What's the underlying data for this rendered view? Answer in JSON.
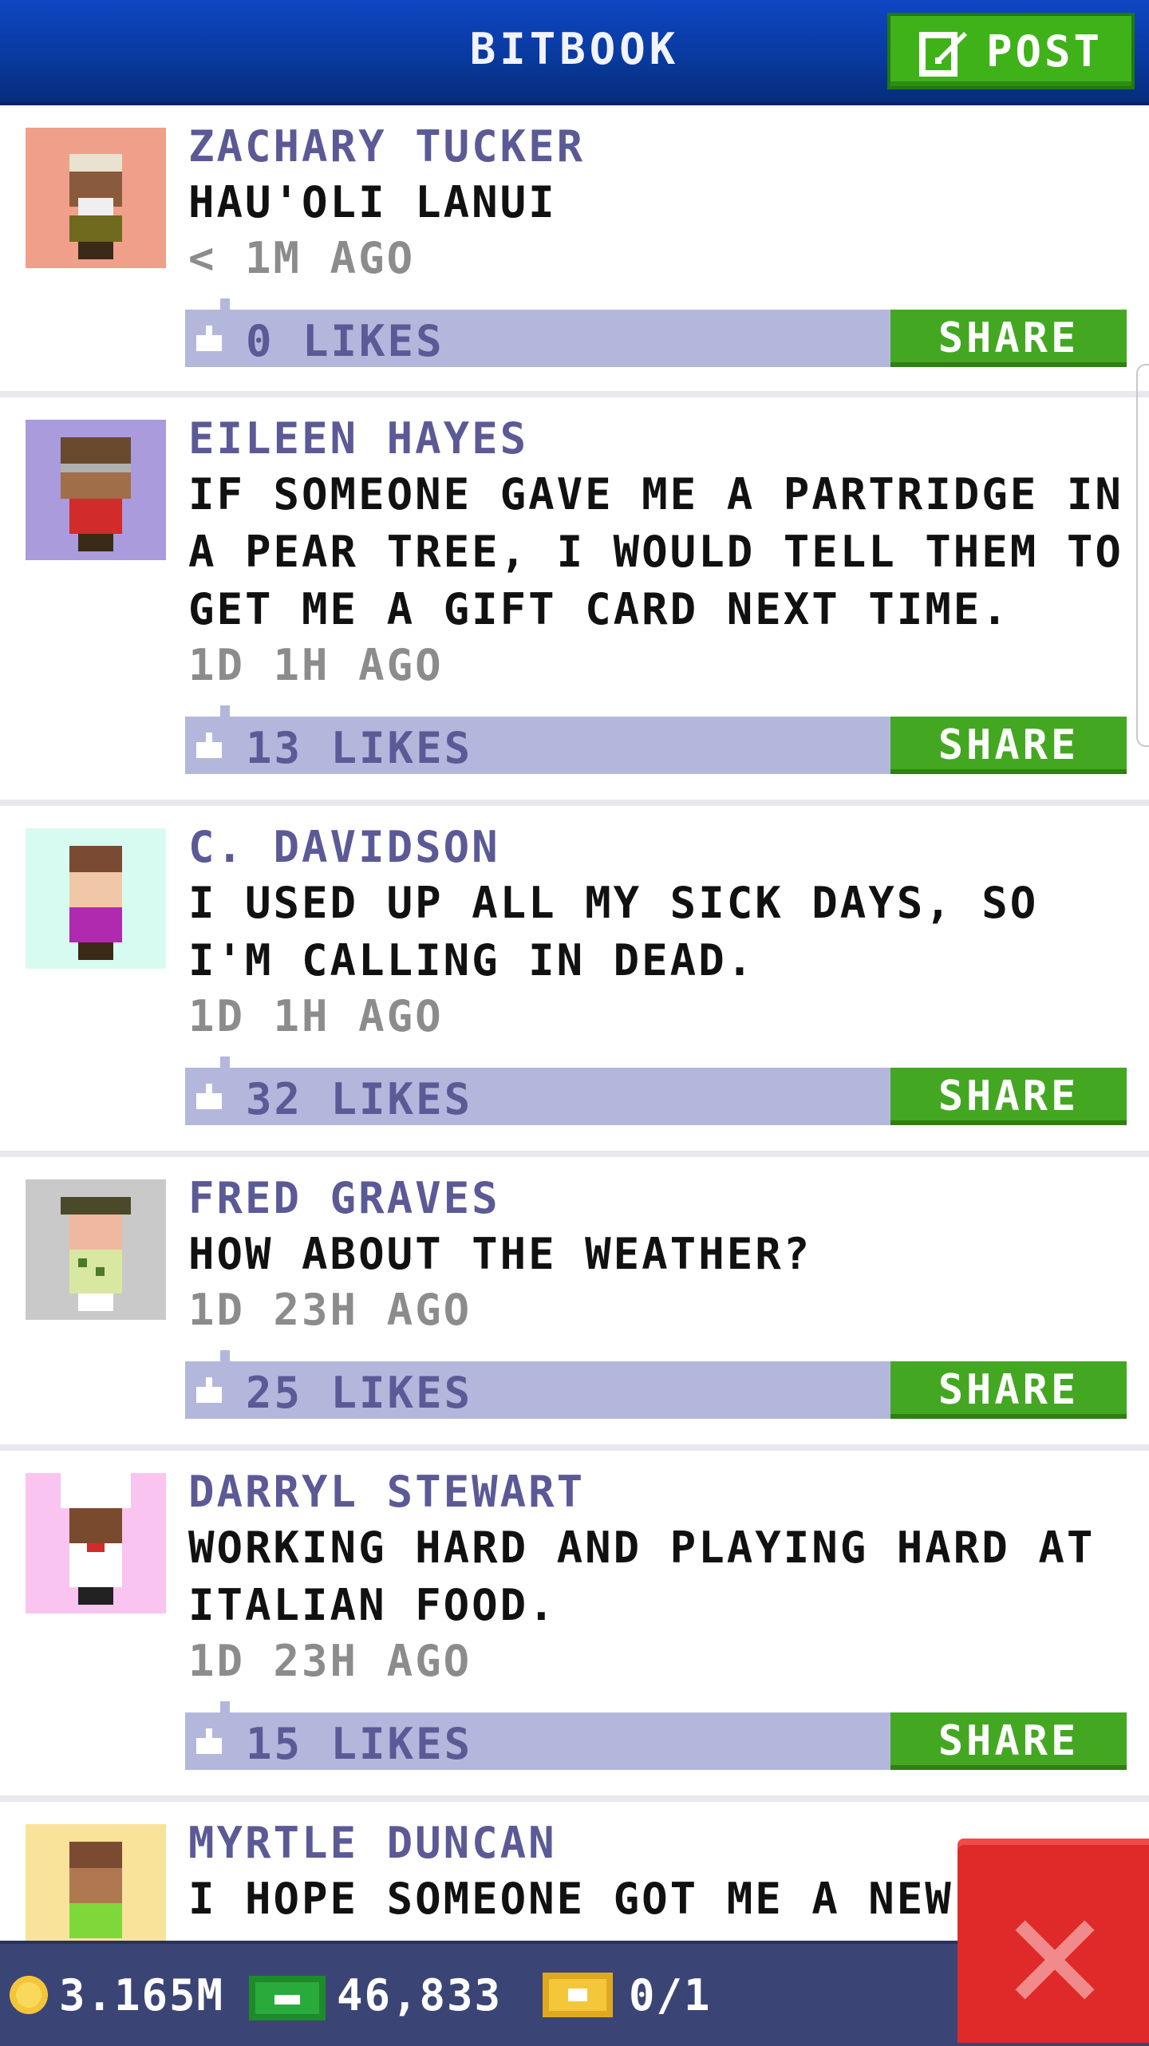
{
  "header": {
    "title": "BITBOOK",
    "post_label": "POST"
  },
  "posts": [
    {
      "author": "ZACHARY TUCKER",
      "message": "HAU'OLI LANUI",
      "time": "< 1M AGO",
      "likes": "0 LIKES",
      "share": "SHARE",
      "avatar_bg": "#f0a08a"
    },
    {
      "author": "EILEEN HAYES",
      "message": "IF SOMEONE GAVE ME A PARTRIDGE IN A PEAR TREE, I WOULD TELL THEM TO GET ME A GIFT CARD NEXT TIME.",
      "time": "1D 1H AGO",
      "likes": "13 LIKES",
      "share": "SHARE",
      "avatar_bg": "#a99bdc"
    },
    {
      "author": "C. DAVIDSON",
      "message": "I USED UP ALL MY SICK DAYS, SO I'M CALLING IN DEAD.",
      "time": "1D 1H AGO",
      "likes": "32 LIKES",
      "share": "SHARE",
      "avatar_bg": "#d8fbf1"
    },
    {
      "author": "FRED GRAVES",
      "message": "HOW ABOUT THE WEATHER?",
      "time": "1D 23H AGO",
      "likes": "25 LIKES",
      "share": "SHARE",
      "avatar_bg": "#c9c9c9"
    },
    {
      "author": "DARRYL STEWART",
      "message": "WORKING HARD AND PLAYING HARD AT ITALIAN FOOD.",
      "time": "1D 23H AGO",
      "likes": "15 LIKES",
      "share": "SHARE",
      "avatar_bg": "#f9c4ef"
    },
    {
      "author": "MYRTLE DUNCAN",
      "message": "I HOPE SOMEONE GOT ME A NEW",
      "avatar_bg": "#f9e39b"
    }
  ],
  "footer": {
    "coins": "3.165M",
    "bux": "46,833",
    "tickets": "0/1"
  },
  "colors": {
    "header": "#093a9f",
    "accent_green": "#44a722",
    "like_bar": "#b3b7dc",
    "author": "#5b5a96",
    "close": "#e02a2a"
  }
}
